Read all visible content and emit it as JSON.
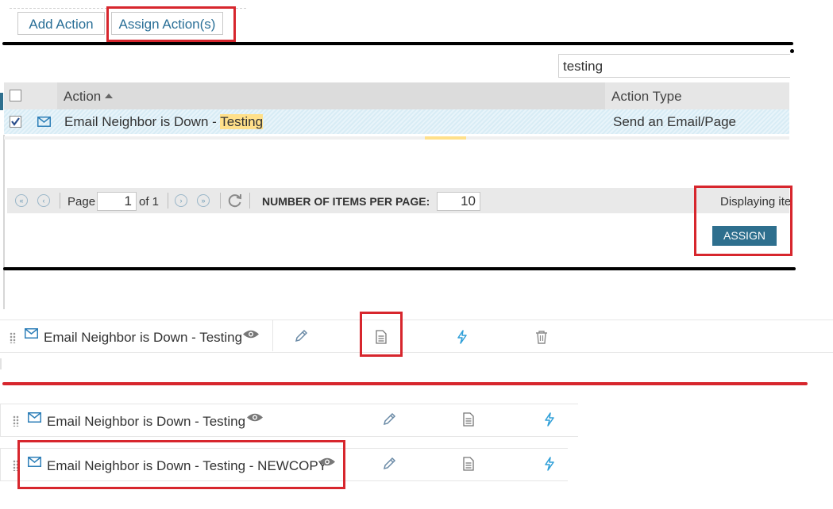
{
  "tabs": {
    "add_action": "Add Action",
    "assign_actions": "Assign Action(s)"
  },
  "search": {
    "value": "testing"
  },
  "grid": {
    "col_action": "Action",
    "col_action_type": "Action Type",
    "row": {
      "name_prefix": "Email Neighbor is Down - ",
      "name_highlight": "Testing",
      "type": "Send an Email/Page",
      "checked": true
    }
  },
  "pager": {
    "page_label": "Page",
    "page_value": "1",
    "of_label": "of 1",
    "items_label": "NUMBER OF ITEMS PER PAGE:",
    "items_value": "10",
    "displaying": "Displaying ite"
  },
  "assign_button": "ASSIGN",
  "assigned_actions": {
    "first": "Email Neighbor is Down - Testing",
    "second": "Email Neighbor is Down - Testing",
    "third": "Email Neighbor is Down - Testing - NEWCOPY"
  },
  "icons": {
    "email": "envelope-icon",
    "view": "eye-icon",
    "edit": "pencil-icon",
    "copy": "document-copy-icon",
    "test": "lightning-icon",
    "delete": "trash-icon"
  },
  "colors": {
    "annotation_red": "#d7262d",
    "accent_blue": "#2a6f97",
    "assign_button": "#2e6f8e",
    "highlight": "#ffe08a"
  }
}
